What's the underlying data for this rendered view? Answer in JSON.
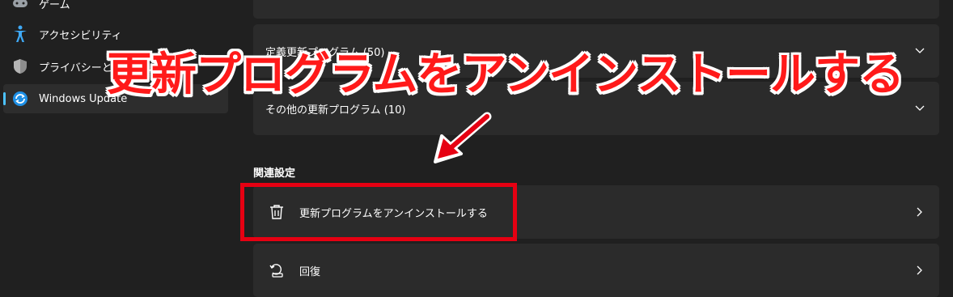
{
  "sidebar": {
    "items": [
      {
        "label": "ゲーム",
        "icon": "gamepad-icon"
      },
      {
        "label": "アクセシビリティ",
        "icon": "accessibility-icon"
      },
      {
        "label": "プライバシーとセキュリティ",
        "icon": "shield-icon"
      },
      {
        "label": "Windows Update",
        "icon": "windows-update-icon",
        "selected": true
      }
    ]
  },
  "main": {
    "top_card_label": "",
    "definition_updates_label": "定義更新プログラム (50)",
    "other_updates_label": "その他の更新プログラム (10)",
    "related_settings_title": "関連設定",
    "uninstall_label": "更新プログラムをアンインストールする",
    "recovery_label": "回復"
  },
  "annotation": {
    "headline": "更新プログラムをアンインストールする",
    "highlight_color": "#e60012"
  },
  "colors": {
    "accent": "#4cc2ff",
    "background": "#202020",
    "card": "#2b2b2b"
  }
}
